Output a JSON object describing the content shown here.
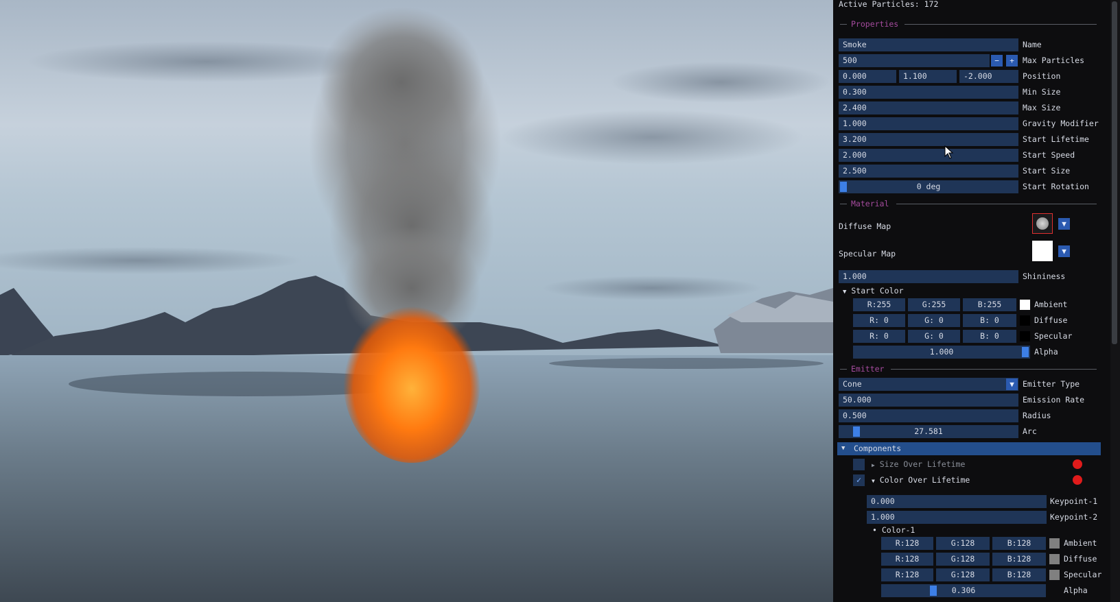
{
  "stats": {
    "active_particles": "Active Particles: 172"
  },
  "sections": {
    "properties": "Properties",
    "material": "Material",
    "emitter": "Emitter"
  },
  "properties": {
    "name": {
      "value": "Smoke",
      "label": "Name"
    },
    "max_particles": {
      "value": "500",
      "label": "Max Particles",
      "minus": "−",
      "plus": "+"
    },
    "position": {
      "x": "0.000",
      "y": "1.100",
      "z": "-2.000",
      "label": "Position"
    },
    "min_size": {
      "value": "0.300",
      "label": "Min Size"
    },
    "max_size": {
      "value": "2.400",
      "label": "Max Size"
    },
    "gravity_modifier": {
      "value": "1.000",
      "label": "Gravity Modifier"
    },
    "start_lifetime": {
      "value": "3.200",
      "label": "Start Lifetime"
    },
    "start_speed": {
      "value": "2.000",
      "label": "Start Speed"
    },
    "start_size": {
      "value": "2.500",
      "label": "Start Size"
    },
    "start_rotation": {
      "value": "0 deg",
      "label": "Start Rotation",
      "slider_fraction": 0.0
    }
  },
  "material": {
    "diffuse_map": {
      "label": "Diffuse Map"
    },
    "specular_map": {
      "label": "Specular Map"
    },
    "shininess": {
      "value": "1.000",
      "label": "Shininess"
    },
    "start_color": {
      "label": "Start Color",
      "ambient": {
        "r": "R:255",
        "g": "G:255",
        "b": "B:255",
        "label": "Ambient",
        "color": "#ffffff"
      },
      "diffuse": {
        "r": "R:  0",
        "g": "G:  0",
        "b": "B:  0",
        "label": "Diffuse",
        "color": "#000000"
      },
      "specular": {
        "r": "R:  0",
        "g": "G:  0",
        "b": "B:  0",
        "label": "Specular",
        "color": "#000000"
      },
      "alpha": {
        "value": "1.000",
        "label": "Alpha",
        "slider_fraction": 1.0
      }
    }
  },
  "emitter": {
    "type": {
      "value": "Cone",
      "label": "Emitter Type"
    },
    "emission_rate": {
      "value": "50.000",
      "label": "Emission Rate"
    },
    "radius": {
      "value": "0.500",
      "label": "Radius"
    },
    "arc": {
      "value": "27.581",
      "label": "Arc",
      "slider_fraction": 0.077
    }
  },
  "components": {
    "header": "Components",
    "size_over_lifetime": {
      "label": "Size Over Lifetime",
      "enabled": false
    },
    "color_over_lifetime": {
      "label": "Color Over Lifetime",
      "enabled": true,
      "keypoint1": {
        "value": "0.000",
        "label": "Keypoint-1"
      },
      "keypoint2": {
        "value": "1.000",
        "label": "Keypoint-2"
      },
      "color1": {
        "label": "Color-1",
        "ambient": {
          "r": "R:128",
          "g": "G:128",
          "b": "B:128",
          "label": "Ambient",
          "color": "#808080"
        },
        "diffuse": {
          "r": "R:128",
          "g": "G:128",
          "b": "B:128",
          "label": "Diffuse",
          "color": "#808080"
        },
        "specular": {
          "r": "R:128",
          "g": "G:128",
          "b": "B:128",
          "label": "Specular",
          "color": "#808080"
        },
        "alpha": {
          "value": "0.306",
          "label": "Alpha",
          "slider_fraction": 0.306
        }
      }
    }
  },
  "icons": {
    "check": "✓",
    "dropdown": "▼",
    "tree_open": "▼",
    "tree_closed": "▶",
    "bullet": "•"
  },
  "colors": {
    "panel_bg": "#0d0d0f",
    "field_bg": "#1f3557",
    "accent": "#3d7fe6",
    "section_title": "#a54b9e",
    "header_bg": "#234e8c",
    "remove_dot": "#e01b1b"
  }
}
